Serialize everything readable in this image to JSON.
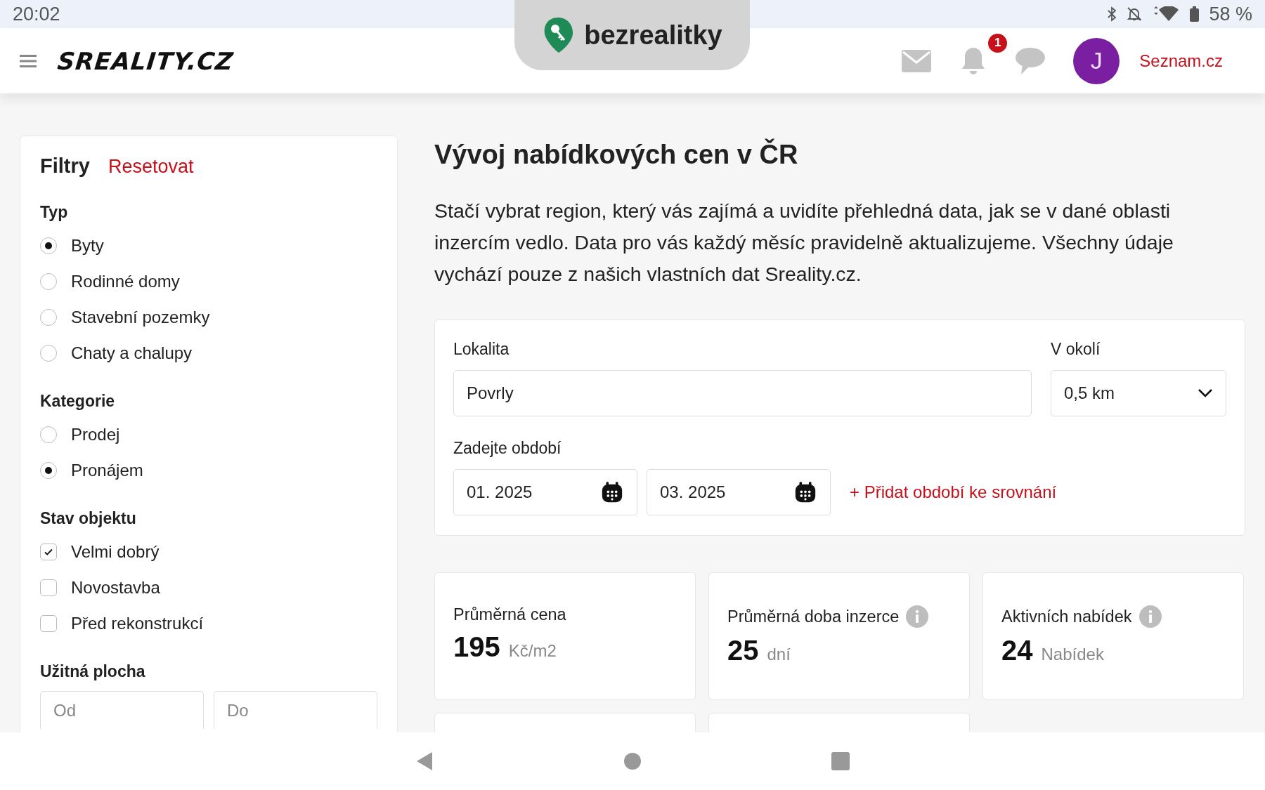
{
  "status_bar": {
    "time": "20:02",
    "battery": "58 %"
  },
  "header": {
    "logo": "SREALITY.CZ",
    "notification_count": "1",
    "avatar": "J",
    "link": "Seznam.cz"
  },
  "overlay_tab": {
    "brand": "bezrealitky"
  },
  "filters": {
    "title": "Filtry",
    "reset": "Resetovat",
    "groups": [
      {
        "heading": "Typ",
        "kind": "radio",
        "options": [
          {
            "label": "Byty",
            "selected": true
          },
          {
            "label": "Rodinné domy",
            "selected": false
          },
          {
            "label": "Stavební pozemky",
            "selected": false
          },
          {
            "label": "Chaty a chalupy",
            "selected": false
          }
        ]
      },
      {
        "heading": "Kategorie",
        "kind": "radio",
        "options": [
          {
            "label": "Prodej",
            "selected": false
          },
          {
            "label": "Pronájem",
            "selected": true
          }
        ]
      },
      {
        "heading": "Stav objektu",
        "kind": "checkbox",
        "options": [
          {
            "label": "Velmi dobrý",
            "checked": true
          },
          {
            "label": "Novostavba",
            "checked": false
          },
          {
            "label": "Před rekonstrukcí",
            "checked": false
          }
        ]
      }
    ],
    "area": {
      "heading": "Užitná plocha",
      "fields": [
        {
          "placeholder": "Od"
        },
        {
          "placeholder": "Do"
        }
      ]
    }
  },
  "main": {
    "title": "Vývoj nabídkových cen v ČR",
    "intro": "Stačí vybrat region, který vás zajímá a uvidíte přehledná data, jak se v dané oblasti inzercím vedlo. Data pro vás každý měsíc pravidelně aktualizujeme. Všechny údaje vychází pouze z našich vlastních dat Sreality.cz.",
    "form": {
      "location_label": "Lokalita",
      "location_value": "Povrly",
      "radius_label": "V okolí",
      "radius_value": "0,5 km",
      "period_label": "Zadejte období",
      "dates": [
        "01. 2025",
        "03. 2025"
      ],
      "add_link": "+ Přidat období ke srovnání"
    },
    "stats": [
      {
        "label": "Průměrná cena",
        "value": "195",
        "unit": "Kč/m2",
        "info": false
      },
      {
        "label": "Průměrná doba inzerce",
        "value": "25",
        "unit": "dní",
        "info": true
      },
      {
        "label": "Aktivních nabídek",
        "value": "24",
        "unit": "Nabídek",
        "info": true
      }
    ]
  }
}
